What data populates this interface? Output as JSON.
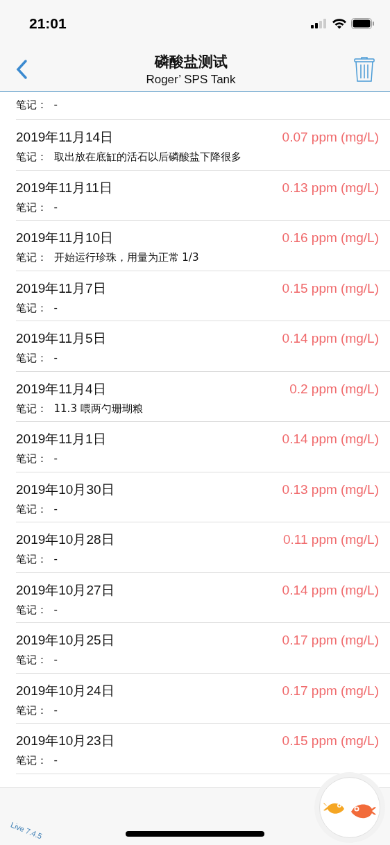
{
  "status_bar": {
    "time": "21:01"
  },
  "nav": {
    "title": "磷酸盐测试",
    "subtitle": "Roger’ SPS Tank"
  },
  "top_partial": {
    "note_label": "笔记：",
    "note": "-"
  },
  "entries": [
    {
      "date": "2019年11月14日",
      "value": "0.07 ppm (mg/L)",
      "note_label": "笔记：",
      "note": "取出放在底缸的活石以后磷酸盐下降很多"
    },
    {
      "date": "2019年11月11日",
      "value": "0.13 ppm (mg/L)",
      "note_label": "笔记：",
      "note": "-"
    },
    {
      "date": "2019年11月10日",
      "value": "0.16 ppm (mg/L)",
      "note_label": "笔记：",
      "note": "开始运行珍珠，用量为正常 1/3"
    },
    {
      "date": "2019年11月7日",
      "value": "0.15 ppm (mg/L)",
      "note_label": "笔记：",
      "note": "-"
    },
    {
      "date": "2019年11月5日",
      "value": "0.14 ppm (mg/L)",
      "note_label": "笔记：",
      "note": "-"
    },
    {
      "date": "2019年11月4日",
      "value": "0.2 ppm (mg/L)",
      "note_label": "笔记：",
      "note": "11.3 喂两勺珊瑚粮"
    },
    {
      "date": "2019年11月1日",
      "value": "0.14 ppm (mg/L)",
      "note_label": "笔记：",
      "note": "-"
    },
    {
      "date": "2019年10月30日",
      "value": "0.13 ppm (mg/L)",
      "note_label": "笔记：",
      "note": "-"
    },
    {
      "date": "2019年10月28日",
      "value": "0.11 ppm (mg/L)",
      "note_label": "笔记：",
      "note": "-"
    },
    {
      "date": "2019年10月27日",
      "value": "0.14 ppm (mg/L)",
      "note_label": "笔记：",
      "note": "-"
    },
    {
      "date": "2019年10月25日",
      "value": "0.17 ppm (mg/L)",
      "note_label": "笔记：",
      "note": "-"
    },
    {
      "date": "2019年10月24日",
      "value": "0.17 ppm (mg/L)",
      "note_label": "笔记：",
      "note": "-"
    },
    {
      "date": "2019年10月23日",
      "value": "0.15 ppm (mg/L)",
      "note_label": "笔记：",
      "note": "-"
    }
  ],
  "footer": {
    "version": "Live 7.4.5"
  }
}
